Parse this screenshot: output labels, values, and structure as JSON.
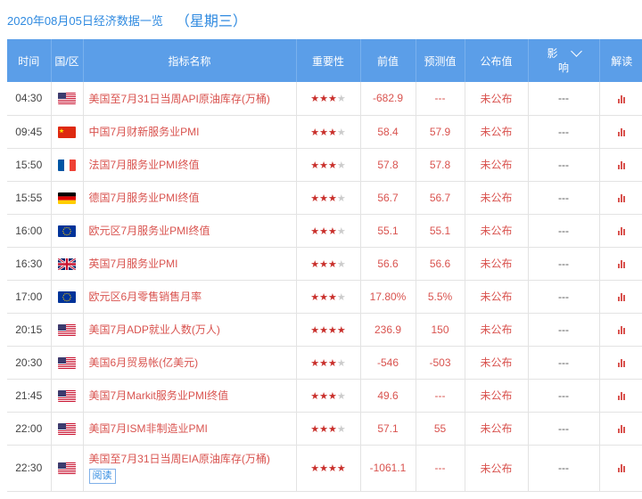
{
  "header": {
    "date_title": "2020年08月05日经济数据一览",
    "weekday": "（星期三）"
  },
  "columns": {
    "time": "时间",
    "region": "国/区",
    "indicator": "指标名称",
    "importance": "重要性",
    "previous": "前值",
    "forecast": "预测值",
    "published": "公布值",
    "impact_top": "影",
    "impact_bottom": "响",
    "analysis": "解读"
  },
  "rows": [
    {
      "time": "04:30",
      "flag": "us",
      "name": "美国至7月31日当周API原油库存(万桶)",
      "stars": 3,
      "prev": "-682.9",
      "fcst": "---",
      "pub": "未公布",
      "impact": "---"
    },
    {
      "time": "09:45",
      "flag": "cn",
      "name": "中国7月财新服务业PMI",
      "stars": 3,
      "prev": "58.4",
      "fcst": "57.9",
      "pub": "未公布",
      "impact": "---"
    },
    {
      "time": "15:50",
      "flag": "fr",
      "name": "法国7月服务业PMI终值",
      "stars": 3,
      "prev": "57.8",
      "fcst": "57.8",
      "pub": "未公布",
      "impact": "---"
    },
    {
      "time": "15:55",
      "flag": "de",
      "name": "德国7月服务业PMI终值",
      "stars": 3,
      "prev": "56.7",
      "fcst": "56.7",
      "pub": "未公布",
      "impact": "---"
    },
    {
      "time": "16:00",
      "flag": "eu",
      "name": "欧元区7月服务业PMI终值",
      "stars": 3,
      "prev": "55.1",
      "fcst": "55.1",
      "pub": "未公布",
      "impact": "---"
    },
    {
      "time": "16:30",
      "flag": "gb",
      "name": "英国7月服务业PMI",
      "stars": 3,
      "prev": "56.6",
      "fcst": "56.6",
      "pub": "未公布",
      "impact": "---"
    },
    {
      "time": "17:00",
      "flag": "eu",
      "name": "欧元区6月零售销售月率",
      "stars": 3,
      "prev": "17.80%",
      "fcst": "5.5%",
      "pub": "未公布",
      "impact": "---"
    },
    {
      "time": "20:15",
      "flag": "us",
      "name": "美国7月ADP就业人数(万人)",
      "stars": 4,
      "prev": "236.9",
      "fcst": "150",
      "pub": "未公布",
      "impact": "---"
    },
    {
      "time": "20:30",
      "flag": "us",
      "name": "美国6月贸易帐(亿美元)",
      "stars": 3,
      "prev": "-546",
      "fcst": "-503",
      "pub": "未公布",
      "impact": "---"
    },
    {
      "time": "21:45",
      "flag": "us",
      "name": "美国7月Markit服务业PMI终值",
      "stars": 3,
      "prev": "49.6",
      "fcst": "---",
      "pub": "未公布",
      "impact": "---"
    },
    {
      "time": "22:00",
      "flag": "us",
      "name": "美国7月ISM非制造业PMI",
      "stars": 3,
      "prev": "57.1",
      "fcst": "55",
      "pub": "未公布",
      "impact": "---"
    },
    {
      "time": "22:30",
      "flag": "us",
      "name": "美国至7月31日当周EIA原油库存(万桶)",
      "stars": 4,
      "prev": "-1061.1",
      "fcst": "---",
      "pub": "未公布",
      "impact": "---",
      "read": "阅读"
    }
  ],
  "colors": {
    "header_bg": "#5b9ee8",
    "accent_red": "#d9534f",
    "title_blue": "#2f8ae0"
  }
}
